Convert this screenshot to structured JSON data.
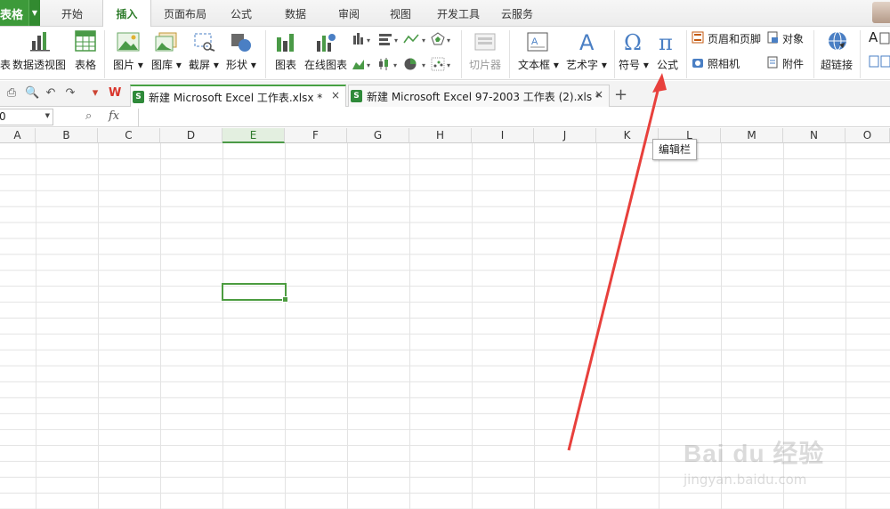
{
  "app_button": {
    "label": "表格"
  },
  "menu_tabs": [
    {
      "label": "开始"
    },
    {
      "label": "插入"
    },
    {
      "label": "页面布局"
    },
    {
      "label": "公式"
    },
    {
      "label": "数据"
    },
    {
      "label": "审阅"
    },
    {
      "label": "视图"
    },
    {
      "label": "开发工具"
    },
    {
      "label": "云服务"
    }
  ],
  "ribbon": {
    "partial_left": "表",
    "pivot": "数据透视图",
    "table": "表格",
    "picture": "图片",
    "gallery": "图库",
    "screenshot": "截屏",
    "shape": "形状",
    "chart": "图表",
    "online_chart": "在线图表",
    "slicer": "切片器",
    "textbox": "文本框",
    "wordart": "艺术字",
    "symbol": "符号",
    "formula": "公式",
    "header_footer": "页眉和页脚",
    "object": "对象",
    "camera": "照相机",
    "attachment": "附件",
    "hyperlink": "超链接",
    "partial_right": "A"
  },
  "doc_tabs": [
    {
      "name": "新建 Microsoft Excel 工作表.xlsx *",
      "close": "×"
    },
    {
      "name": "新建 Microsoft Excel 97-2003 工作表 (2).xls *",
      "close": "×"
    }
  ],
  "new_tab": "+",
  "namebox": {
    "value": "0"
  },
  "formula_bar": {
    "fx_label": "fx",
    "value": ""
  },
  "columns": [
    "A",
    "B",
    "C",
    "D",
    "E",
    "F",
    "G",
    "H",
    "I",
    "J",
    "K",
    "L",
    "M",
    "N",
    "O"
  ],
  "active_column": "E",
  "tooltip": "编辑栏",
  "watermark": {
    "main": "Bai du 经验",
    "sub": "jingyan.baidu.com"
  },
  "colors": {
    "accent_green": "#3d9a3a",
    "arrow_red": "#e8403c"
  }
}
